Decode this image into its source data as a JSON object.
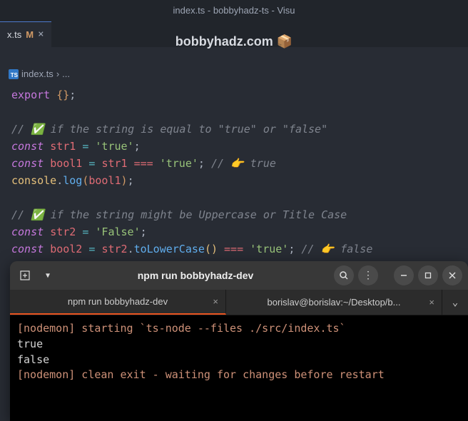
{
  "titlebar": "index.ts - bobbyhadz-ts - Visu",
  "tab": {
    "name": "x.ts",
    "modified": "M"
  },
  "watermark": "bobbyhadz.com 📦",
  "breadcrumb": {
    "file": "index.ts",
    "sep": "›",
    "rest": "..."
  },
  "code": {
    "l1_export": "export",
    "l1_braces": " {}",
    "l1_semi": ";",
    "c1": "// ✅ if the string is equal to \"true\" or \"false\"",
    "const": "const",
    "str1": "str1",
    "eq": " = ",
    "true_lit": "'true'",
    "semi": ";",
    "bool1": "bool1",
    "eqeq": " === ",
    "c_true": "// 👉️ true",
    "console": "console",
    "dot": ".",
    "log": "log",
    "lp": "(",
    "rp": ")",
    "c2": "// ✅ if the string might be Uppercase or Title Case",
    "str2": "str2",
    "false_lit": "'False'",
    "bool2": "bool2",
    "toLower": "toLowerCase",
    "empty_args": "()",
    "c_false": "// 👉️ false"
  },
  "terminal": {
    "title": "npm run bobbyhadz-dev",
    "tabs": {
      "t1": "npm run bobbyhadz-dev",
      "t2": "borislav@borislav:~/Desktop/b..."
    },
    "out": {
      "l1a": "[nodemon] starting ",
      "l1b": "`ts-node --files ./src/index.ts`",
      "l2": "true",
      "l3": "false",
      "l4": "[nodemon] clean exit - waiting for changes before restart"
    }
  }
}
